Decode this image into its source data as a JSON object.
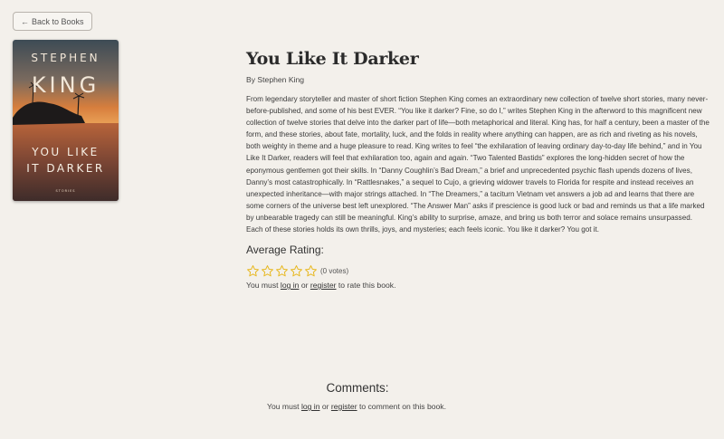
{
  "nav": {
    "back_label": "Back to Books"
  },
  "book": {
    "title": "You Like It Darker",
    "author_line": "By Stephen King",
    "description": "From legendary storyteller and master of short fiction Stephen King comes an extraordinary new collection of twelve short stories, many never-before-published, and some of his best EVER. “You like it darker? Fine, so do I,” writes Stephen King in the afterword to this magnificent new collection of twelve stories that delve into the darker part of life—both metaphorical and literal. King has, for half a century, been a master of the form, and these stories, about fate, mortality, luck, and the folds in reality where anything can happen, are as rich and riveting as his novels, both weighty in theme and a huge pleasure to read. King writes to feel “the exhilaration of leaving ordinary day-to-day life behind,” and in You Like It Darker, readers will feel that exhilaration too, again and again. “Two Talented Bastids” explores the long-hidden secret of how the eponymous gentlemen got their skills. In “Danny Coughlin’s Bad Dream,” a brief and unprecedented psychic flash upends dozens of lives, Danny’s most catastrophically. In “Rattlesnakes,” a sequel to Cujo, a grieving widower travels to Florida for respite and instead receives an unexpected inheritance—with major strings attached. In “The Dreamers,” a taciturn Vietnam vet answers a job ad and learns that there are some corners of the universe best left unexplored. “The Answer Man” asks if prescience is good luck or bad and reminds us that a life marked by unbearable tragedy can still be meaningful. King’s ability to surprise, amaze, and bring us both terror and solace remains unsurpassed. Each of these stories holds its own thrills, joys, and mysteries; each feels iconic. You like it darker? You got it.",
    "cover": {
      "author_top": "STEPHEN",
      "author_bottom": "KING",
      "title_line1": "YOU LIKE",
      "title_line2": "IT DARKER",
      "subtitle": "STORIES"
    }
  },
  "rating": {
    "heading": "Average Rating:",
    "value": 0,
    "max_stars": 5,
    "votes_text": "(0 votes)",
    "note_prefix": "You must ",
    "login_label": "log in",
    "or_text": " or ",
    "register_label": "register",
    "note_suffix": " to rate this book.",
    "star_color": "#e8b923"
  },
  "comments": {
    "heading": "Comments:",
    "note_prefix": "You must ",
    "login_label": "log in",
    "or_text": " or ",
    "register_label": "register",
    "note_suffix": " to comment on this book."
  }
}
